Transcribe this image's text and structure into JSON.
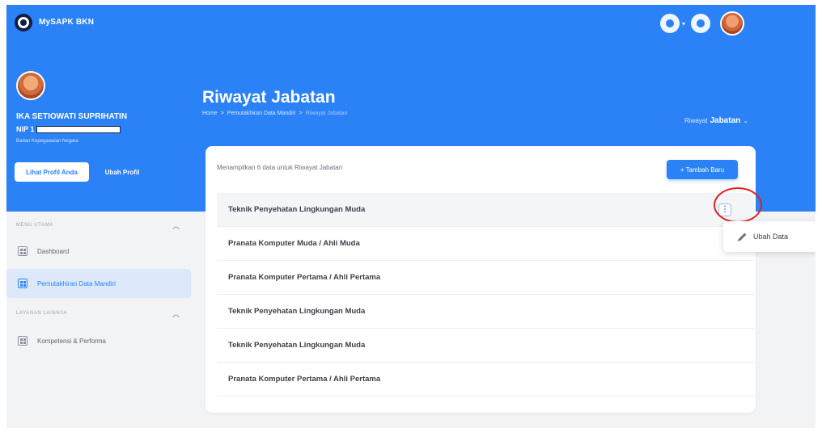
{
  "header": {
    "app_title": "MySAPK BKN",
    "top_icons": [
      "help-icon",
      "notification-icon",
      "user-avatar"
    ]
  },
  "profile": {
    "name": "IKA SETIOWATI SUPRIHATIN",
    "nip_label": "NIP 1",
    "organization": "Badan Kepegawaian Negara",
    "view_profile_label": "Lihat Profil Anda",
    "edit_profile_label": "Ubah Profil"
  },
  "page": {
    "title": "Riwayat Jabatan",
    "breadcrumb": [
      "Home",
      ">",
      "Pemutakhiran Data Mandiri",
      ">",
      "Riwayat Jabatan"
    ],
    "dropdown_prefix": "Riwayat",
    "dropdown_value": "Jabatan",
    "dropdown_chevron": "⌄"
  },
  "sidebar": {
    "sections": [
      {
        "title": "MENU UTAMA",
        "items": [
          {
            "label": "Dashboard",
            "icon": "dashboard-icon",
            "active": false
          },
          {
            "label": "Pemutakhiran Data Mandiri",
            "icon": "data-update-icon",
            "active": true
          }
        ]
      },
      {
        "title": "LAYANAN LAINNYA",
        "items": [
          {
            "label": "Kompetensi & Performa",
            "icon": "competency-icon",
            "active": false
          }
        ]
      }
    ]
  },
  "card": {
    "summary": "Menampilkan 6 data untuk Riwayat Jabatan",
    "add_button_label": "+ Tambah Baru",
    "rows": [
      "Teknik Penyehatan Lingkungan Muda",
      "Pranata Komputer Muda / Ahli Muda",
      "Pranata Komputer Pertama / Ahli Pertama",
      "Teknik Penyehatan Lingkungan Muda",
      "Teknik Penyehatan Lingkungan Muda",
      "Pranata Komputer Pertama / Ahli Pertama"
    ],
    "more_button_glyph": "⋮"
  },
  "popover": {
    "edit_label": "Ubah Data"
  },
  "colors": {
    "brand_blue": "#2a82f6",
    "highlight_red": "#e02020",
    "active_nav_bg": "#dde9fb"
  }
}
